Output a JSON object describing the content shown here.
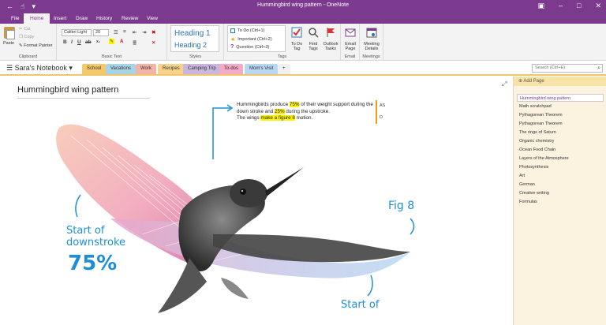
{
  "window": {
    "title": "Hummingbird wing pattern  -  OneNote"
  },
  "ribbon_tabs": [
    "File",
    "Home",
    "Insert",
    "Draw",
    "History",
    "Review",
    "View"
  ],
  "clipboard": {
    "paste": "Paste",
    "cut": "Cut",
    "copy": "Copy",
    "format_painter": "Format Painter",
    "label": "Clipboard"
  },
  "basic_text": {
    "font": "Calibri Light",
    "size": "20",
    "label": "Basic Text"
  },
  "styles": {
    "heading1": "Heading 1",
    "heading2": "Heading 2",
    "label": "Styles"
  },
  "tags": {
    "todo": "To Do (Ctrl+1)",
    "important": "Important (Ctrl+2)",
    "question": "Question (Ctrl+3)",
    "todo_tag": [
      "To Do",
      "Tag"
    ],
    "find_tags": [
      "Find",
      "Tags"
    ],
    "outlook_tasks": [
      "Outlook",
      "Tasks"
    ],
    "label": "Tags"
  },
  "email": {
    "button": [
      "Email",
      "Page"
    ],
    "label": "Email"
  },
  "meetings": {
    "button": [
      "Meeting",
      "Details"
    ],
    "label": "Meetings"
  },
  "notebook": {
    "name": "Sara's Notebook",
    "sections": [
      {
        "name": "School",
        "color": "#f5c86b"
      },
      {
        "name": "Vacations",
        "color": "#a8d4e8"
      },
      {
        "name": "Work",
        "color": "#f4b3a8"
      },
      {
        "name": "Recipes",
        "color": "#f6d28a"
      },
      {
        "name": "Camping Trip",
        "color": "#c9b7e0"
      },
      {
        "name": "To-dos",
        "color": "#f5a9c8"
      },
      {
        "name": "Mom's Visit",
        "color": "#b9d6f2"
      },
      {
        "name": "+",
        "color": "#f0f0f0"
      }
    ]
  },
  "search": {
    "placeholder": "Search (Ctrl+E)"
  },
  "page": {
    "title": "Hummingbird wing pattern",
    "note": {
      "p1_a": "Hummingbirds produce ",
      "p1_hl1": "75%",
      "p1_b": " of their weight support during the down stroke and ",
      "p1_hl2": "25%",
      "p1_c": " during the upstroke.",
      "p2_a": "The wings ",
      "p2_hl": "make a figure 8",
      "p2_b": " motion."
    },
    "side_marks": [
      "AS",
      "D"
    ]
  },
  "handwriting": {
    "start_downstroke_1": "Start of",
    "start_downstroke_2": "downstroke",
    "pct": "75%",
    "fig8": "Fig 8",
    "start_of_bottom": "Start of"
  },
  "pages": {
    "add_label": "Add Page",
    "items": [
      "Hummingbird wing pattern",
      "Math scratchpad",
      "Pythagorean Theorem",
      "Pythagorean Theorem",
      "The rings of Saturn",
      "Organic chemistry",
      "Ocean Food Chain",
      "Layers of the Atmosphere",
      "Photosynthesis",
      "Art",
      "German",
      "Creative writing",
      "Formulas"
    ]
  }
}
